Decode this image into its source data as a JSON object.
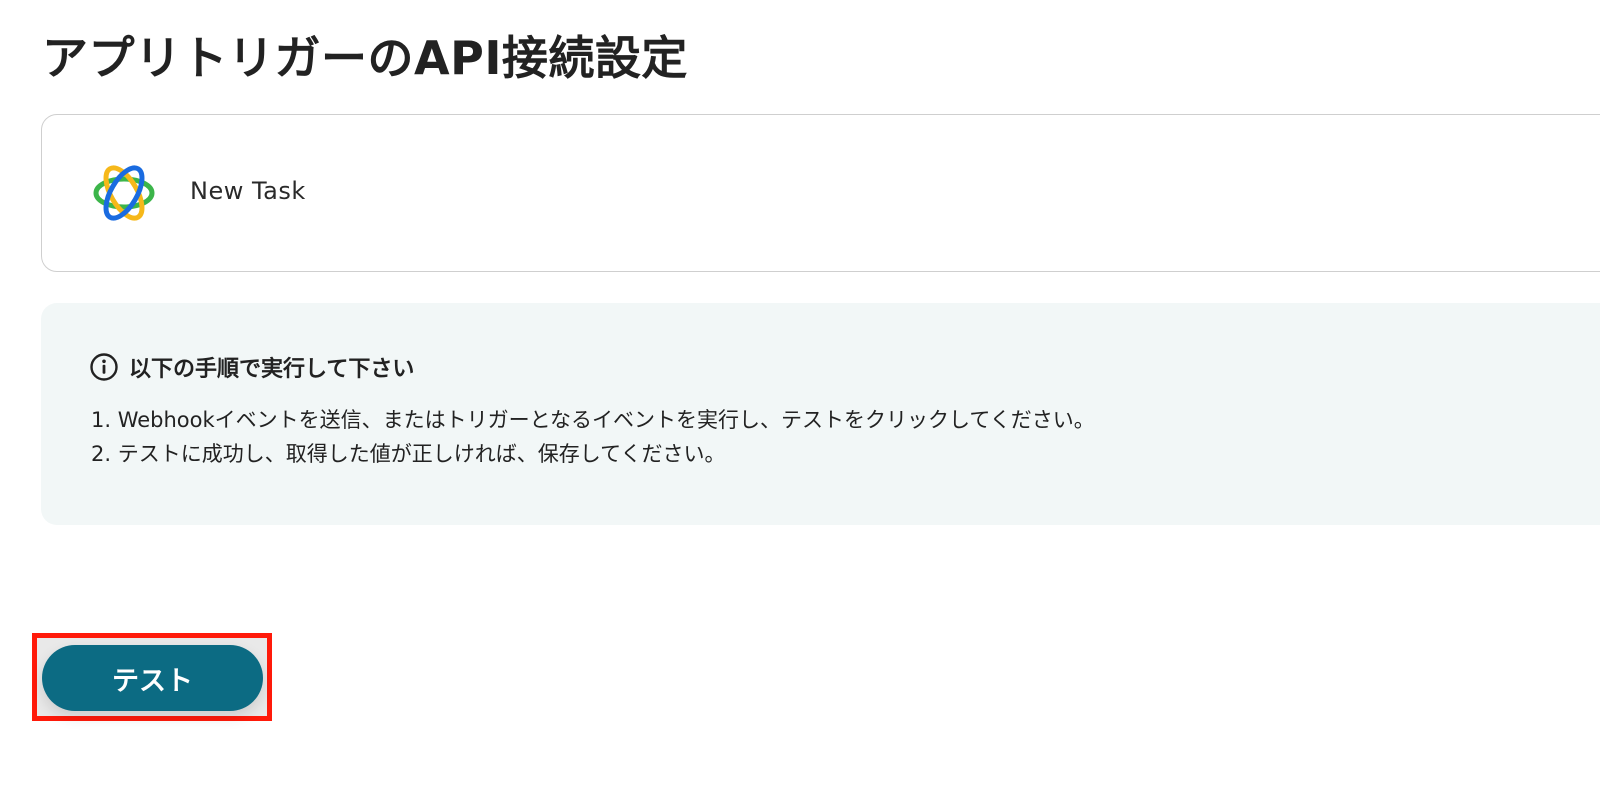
{
  "page": {
    "title": "アプリトリガーのAPI接続設定"
  },
  "app_card": {
    "logo_icon": "app-logo-icon",
    "name": "New Task"
  },
  "instructions": {
    "icon": "info-icon",
    "title": "以下の手順で実行して下さい",
    "steps": [
      "1. Webhookイベントを送信、またはトリガーとなるイベントを実行し、テストをクリックしてください。",
      "2. テストに成功し、取得した値が正しければ、保存してください。"
    ]
  },
  "actions": {
    "test_label": "テスト"
  },
  "colors": {
    "button_bg": "#0c6b83",
    "highlight_border": "#ff1a0a",
    "info_bg": "#f2f7f7"
  }
}
